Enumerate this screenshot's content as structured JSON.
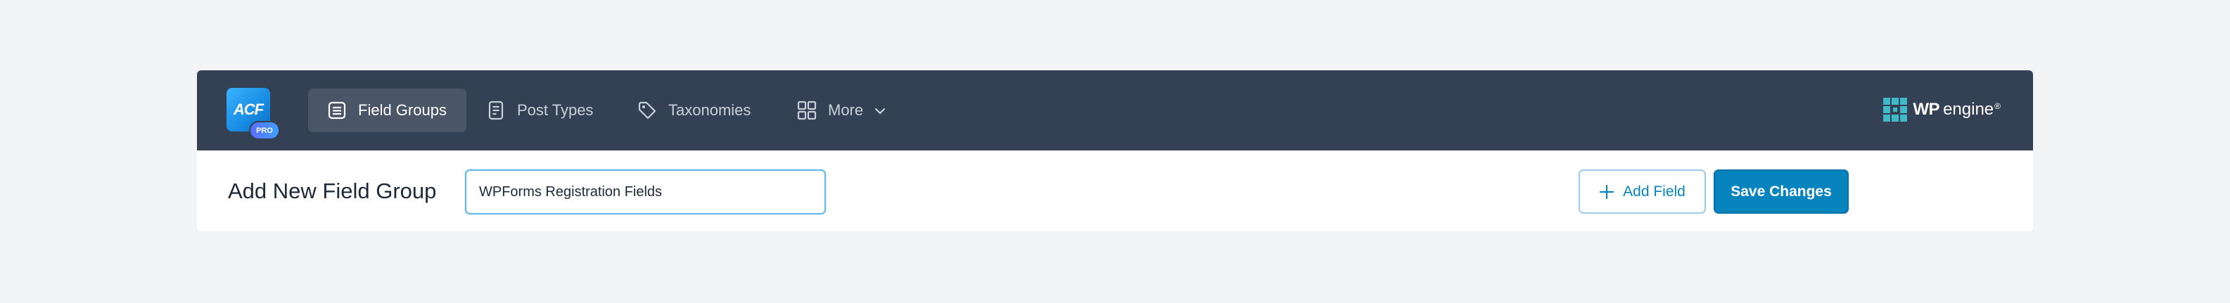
{
  "app": {
    "logo_text": "ACF",
    "logo_badge": "PRO"
  },
  "nav": {
    "items": [
      {
        "label": "Field Groups",
        "icon": "field-groups-icon",
        "active": true
      },
      {
        "label": "Post Types",
        "icon": "post-types-icon",
        "active": false
      },
      {
        "label": "Taxonomies",
        "icon": "tag-icon",
        "active": false
      },
      {
        "label": "More",
        "icon": "grid-icon",
        "active": false
      }
    ]
  },
  "brand": {
    "bold": "WP",
    "light": "engine",
    "mark": "®"
  },
  "header": {
    "title": "Add New Field Group",
    "title_input_value": "WPForms Registration Fields",
    "add_field_label": "Add Field",
    "save_label": "Save Changes"
  },
  "colors": {
    "topbar": "#344054",
    "active_nav": "#4a5568",
    "accent": "#0783be",
    "page_bg": "#f3f4f6"
  }
}
